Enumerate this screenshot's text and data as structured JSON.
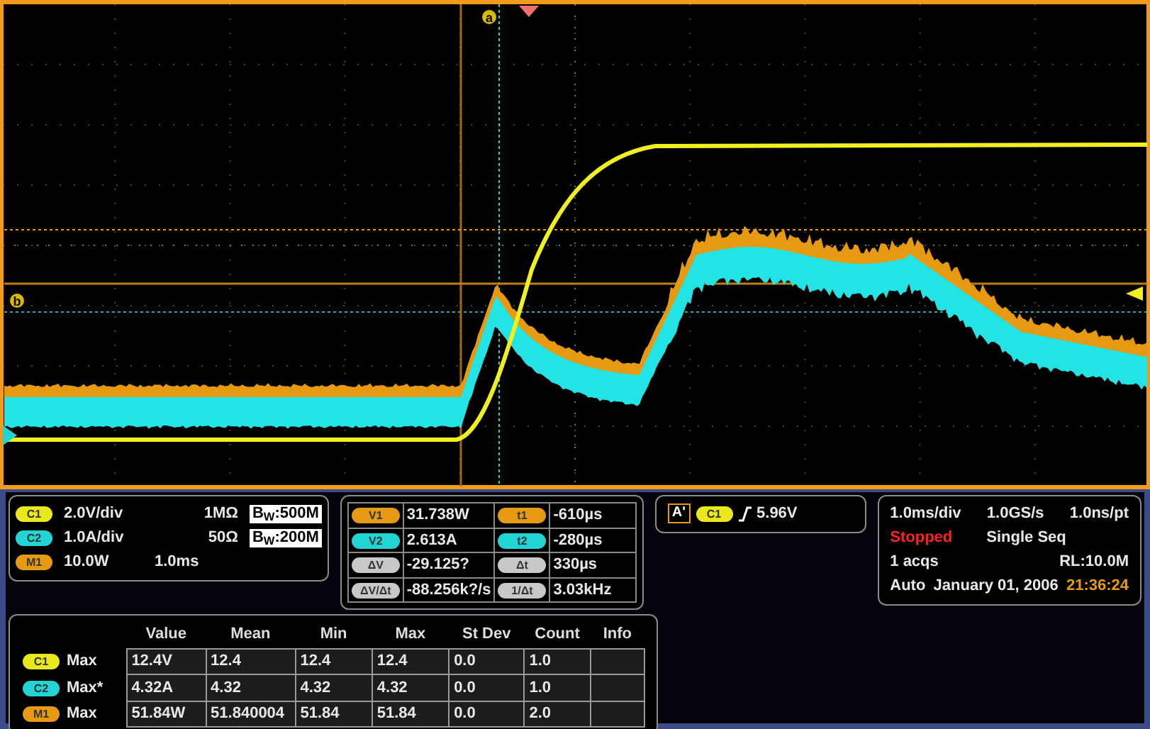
{
  "display": {
    "cursor_markers": [
      {
        "label": "a"
      },
      {
        "label": "b"
      }
    ]
  },
  "channels": [
    {
      "badge": "C1",
      "color": "#e8e81c",
      "scale": "2.0V/div",
      "impedance": "1MΩ",
      "bandwidth": "B$_{W}$:500M"
    },
    {
      "badge": "C2",
      "color": "#22d4d4",
      "scale": "1.0A/div",
      "impedance": "50Ω",
      "bandwidth": "B$_{W}$:200M"
    },
    {
      "badge": "M1",
      "color": "#e59a12",
      "scale": "10.0W",
      "timebase": "1.0ms"
    }
  ],
  "cursors": [
    {
      "amplitude": {
        "badge": "V1",
        "color": "#e59a12",
        "value": "31.738W"
      },
      "time": {
        "badge": "t1",
        "color": "#e59a12",
        "value": "-610µs"
      }
    },
    {
      "amplitude": {
        "badge": "V2",
        "color": "#22d4d4",
        "value": "2.613A"
      },
      "time": {
        "badge": "t2",
        "color": "#22d4d4",
        "value": "-280µs"
      }
    },
    {
      "amplitude": {
        "badge": "ΔV",
        "color": "#c8c8c8",
        "value": "-29.125?"
      },
      "time": {
        "badge": "Δt",
        "color": "#c8c8c8",
        "value": "330µs"
      }
    },
    {
      "amplitude": {
        "badge": "ΔV/Δt",
        "color": "#c8c8c8",
        "value": "-88.256k?/s"
      },
      "time": {
        "badge": "1/Δt",
        "color": "#c8c8c8",
        "value": "3.03kHz"
      }
    }
  ],
  "trigger": {
    "type": "A'",
    "badge": "C1",
    "color": "#e8e81c",
    "level": "5.96V"
  },
  "acquisition": {
    "scale": "1.0ms/div",
    "rate": "1.0GS/s",
    "resolution": "1.0ns/pt",
    "state": "Stopped",
    "mode": "Single Seq",
    "acqs": "1 acqs",
    "record_length": "RL:10.0M",
    "trigger_mode": "Auto",
    "date": "January 01, 2006",
    "time": "21:36:24"
  },
  "measurements": {
    "columns": [
      "Value",
      "Mean",
      "Min",
      "Max",
      "St Dev",
      "Count",
      "Info"
    ],
    "rows": [
      {
        "badge": "C1",
        "color": "#e8e81c",
        "type": "Max",
        "cells": [
          "12.4V",
          "12.4",
          "12.4",
          "12.4",
          "0.0",
          "1.0",
          ""
        ]
      },
      {
        "badge": "C2",
        "color": "#22d4d4",
        "type": "Max*",
        "cells": [
          "4.32A",
          "4.32",
          "4.32",
          "4.32",
          "0.0",
          "1.0",
          ""
        ]
      },
      {
        "badge": "M1",
        "color": "#e59a12",
        "type": "Max",
        "cells": [
          "51.84W",
          "51.840004",
          "51.84",
          "51.84",
          "0.0",
          "2.0",
          ""
        ]
      }
    ]
  }
}
